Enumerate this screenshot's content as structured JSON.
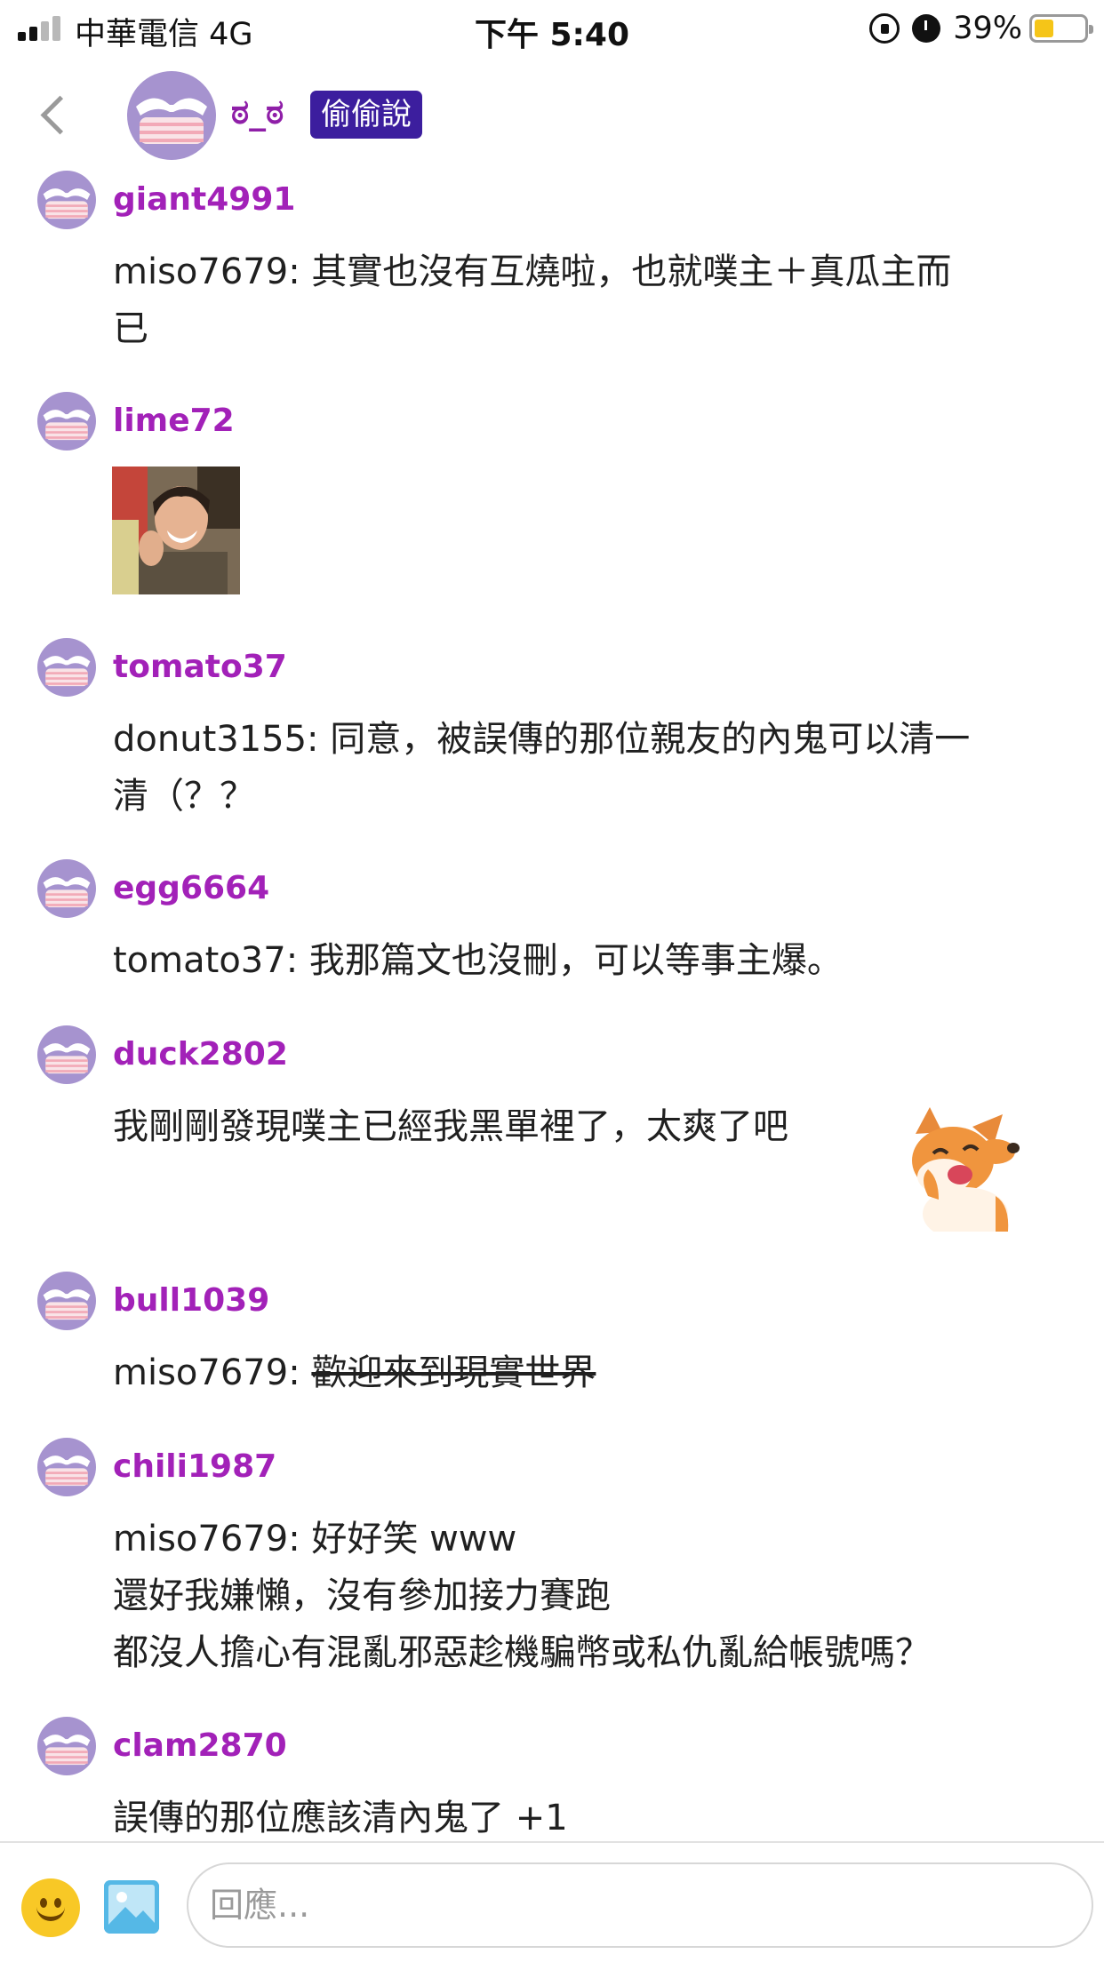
{
  "status_bar": {
    "carrier": "中華電信 4G",
    "time": "下午 5:40",
    "battery_percent": "39%",
    "battery_level": 0.39,
    "icons": [
      "signal-icon",
      "rotation-lock-icon",
      "alarm-icon",
      "battery-icon"
    ]
  },
  "header": {
    "name": "ಠ_ಠ",
    "badge": "偷偷說",
    "back_icon": "chevron-left-icon"
  },
  "messages": [
    {
      "user": "giant4991",
      "lines": [
        "miso7679: 其實也沒有互燒啦，也就噗主＋真瓜主而",
        "已"
      ]
    },
    {
      "user": "lime72",
      "image": "laughing-man-photo"
    },
    {
      "user": "tomato37",
      "lines": [
        "donut3155: 同意，被誤傳的那位親友的內鬼可以清一",
        "清（？？"
      ]
    },
    {
      "user": "egg6664",
      "lines": [
        "tomato37: 我那篇文也沒刪，可以等事主爆。"
      ]
    },
    {
      "user": "duck2802",
      "lines": [
        "我剛剛發現噗主已經我黑單裡了，太爽了吧"
      ],
      "sticker": "laughing-fox-sticker"
    },
    {
      "user": "bull1039",
      "prefix": "miso7679: ",
      "strike": "歡迎來到現實世界"
    },
    {
      "user": "chili1987",
      "lines": [
        "miso7679: 好好笑 www",
        "還好我嫌懶，沒有參加接力賽跑",
        "都沒人擔心有混亂邪惡趁機騙幣或私仇亂給帳號嗎？"
      ]
    },
    {
      "user": "clam2870",
      "lines": [
        "誤傳的那位應該清內鬼了 +1"
      ]
    }
  ],
  "input_bar": {
    "placeholder": "回應...",
    "emoji_icon": "smiley-icon",
    "image_icon": "image-icon"
  },
  "colors": {
    "username": "#a221b8",
    "badge_bg": "#3c1e9e",
    "avatar_purple": "#a693cf",
    "avatar_pink": "#f4b8c4"
  }
}
